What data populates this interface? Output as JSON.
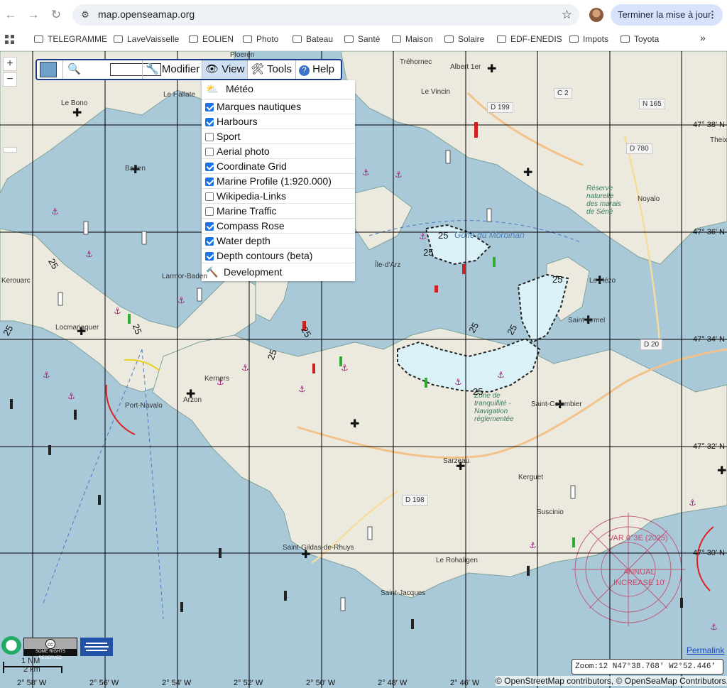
{
  "browser": {
    "url": "map.openseamap.org",
    "update_button": "Terminer la mise à jour",
    "bookmarks": [
      {
        "label": "TELEGRAMME"
      },
      {
        "label": "LaveVaisselle"
      },
      {
        "label": "EOLIEN"
      },
      {
        "label": "Photo"
      },
      {
        "label": "Bateau"
      },
      {
        "label": "Santé"
      },
      {
        "label": "Maison"
      },
      {
        "label": "Solaire"
      },
      {
        "label": "EDF-ENEDIS"
      },
      {
        "label": "Impots"
      },
      {
        "label": "Toyota"
      }
    ],
    "more_label": "»"
  },
  "map": {
    "zoom_in": "+",
    "zoom_out": "−",
    "toolbar": {
      "search_value": "",
      "modifier": "Modifier",
      "view": "View",
      "tools": "Tools",
      "help": "Help"
    },
    "view_menu": {
      "weather": "Météo",
      "items": [
        {
          "label": "Marques nautiques",
          "checked": true
        },
        {
          "label": "Harbours",
          "checked": true
        },
        {
          "label": "Sport",
          "checked": false
        },
        {
          "label": "Aerial photo",
          "checked": false
        },
        {
          "label": "Coordinate Grid",
          "checked": true
        },
        {
          "label": "Marine Profile (1:920.000)",
          "checked": true
        },
        {
          "label": "Wikipedia-Links",
          "checked": false
        },
        {
          "label": "Marine Traffic",
          "checked": false
        },
        {
          "label": "Compass Rose",
          "checked": true
        },
        {
          "label": "Water depth",
          "checked": true
        },
        {
          "label": "Depth contours (beta)",
          "checked": true
        }
      ],
      "development": "Development"
    },
    "lat_labels": [
      "47° 38′ N",
      "47° 36′ N",
      "47° 34′ N",
      "47° 32′ N",
      "47° 30′ N"
    ],
    "lon_labels": [
      "2° 58′ W",
      "2° 56′ W",
      "2° 54′ W",
      "2° 52′ W",
      "2° 50′ W",
      "2° 48′ W",
      "2° 46′ W"
    ],
    "places": [
      "Ploeren",
      "Tréhornec",
      "Albert 1er",
      "Le Vincin",
      "Le Bono",
      "Le Hallate",
      "Baden",
      "Theix",
      "Noyalo",
      "Île-d'Arz",
      "Golfe du Morbihan",
      "Larmor-Baden",
      "Kerouarc",
      "Locmariaquer",
      "Le Hézo",
      "Saint-Armel",
      "Kerners",
      "Arzon",
      "Port-Navalo",
      "Saint-Gildas-de-Rhuys",
      "Sarzeau",
      "Kerguet",
      "Suscinio",
      "Saint-Colombier",
      "Le Rohaligen",
      "Saint-Jacques",
      "Réserve naturelle des marais de Séné",
      "Zone de tranquillité - Navigation réglementée"
    ],
    "roads": [
      "C 2",
      "N 165",
      "D 780",
      "D 20",
      "D 198",
      "D 199"
    ],
    "depth_label": "25",
    "compass_text": [
      "VAR 0°3E (2025)",
      "ANNUAL",
      "INCREASE 10'"
    ],
    "scale": {
      "nm": "1 NM",
      "km": "2 km"
    },
    "cc_badge": "SOME RIGHTS RESERVED",
    "permalink": "Permalink",
    "zoom_readout": "Zoom:12 N47°38.768' W2°52.446'",
    "attribution": "© OpenStreetMap contributors, © OpenSeaMap Contributors,"
  },
  "colors": {
    "sea": "#aac9d8",
    "land": "#eceadf",
    "shallow": "#d9f1f7",
    "grid": "#000000",
    "toolbar_border": "#1b3a8a",
    "marine_magenta": "#a0207a",
    "checkbox": "#1a73e8"
  }
}
